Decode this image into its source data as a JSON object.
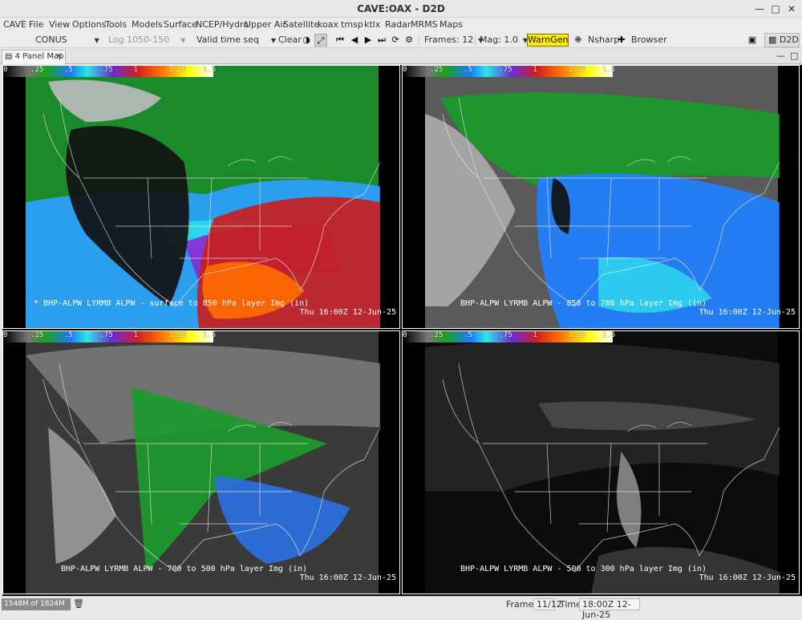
{
  "window": {
    "title": "CAVE:OAX - D2D"
  },
  "menus": [
    "CAVE",
    "File",
    "View",
    "Options",
    "Tools",
    "Models",
    "Surface",
    "NCEP/Hydro",
    "Upper Air",
    "Satellite",
    "koax",
    "tmsp",
    "ktlx",
    "Radar",
    "MRMS",
    "Maps"
  ],
  "toolbar": {
    "scale": "CONUS",
    "density": "Log 1050-150",
    "time_match": "Valid time seq",
    "clear": "Clear",
    "frames": "Frames: 12",
    "mag": "Mag: 1.0",
    "warngen": "WarnGen",
    "nsharp": "Nsharp",
    "browser": "Browser",
    "perspective": "D2D"
  },
  "tab": {
    "label": "4 Panel Map"
  },
  "colorbar": {
    "ticks": [
      "0",
      ".25",
      ".5",
      ".75",
      "1",
      "1.25",
      "1.5"
    ],
    "colors": {
      "pw_start": "#000000",
      "pw_green": "#19a319",
      "pw_blue": "#1e78ff",
      "pw_cyan": "#2ee6e6",
      "pw_purple": "#6a2bd6",
      "pw_red": "#d41e1e",
      "pw_orange": "#ff7a00",
      "pw_yellow": "#ffff00",
      "pw_end": "#ffffff"
    }
  },
  "panels": [
    {
      "product": "* BHP-ALPW LYRMB ALPW - surface to 850 hPa layer Img (in)",
      "time": "Thu 16:00Z 12-Jun-25",
      "theme": "low"
    },
    {
      "product": "BHP-ALPW LYRMB ALPW - 850 to 700 hPa layer Img (in)",
      "time": "Thu 16:00Z 12-Jun-25",
      "theme": "mid"
    },
    {
      "product": "BHP-ALPW LYRMB ALPW - 700 to 500 hPa layer Img (in)",
      "time": "Thu 16:00Z 12-Jun-25",
      "theme": "upper"
    },
    {
      "product": "BHP-ALPW LYRMB ALPW - 500 to 300 hPa layer Img (in)",
      "time": "Thu 16:00Z 12-Jun-25",
      "theme": "top"
    }
  ],
  "status": {
    "memory": "1548M of 1824M",
    "frames_label": "Frames:",
    "frames_value": "11/12",
    "time_label": "Time:",
    "time_value": "18:00Z 12-Jun-25"
  }
}
